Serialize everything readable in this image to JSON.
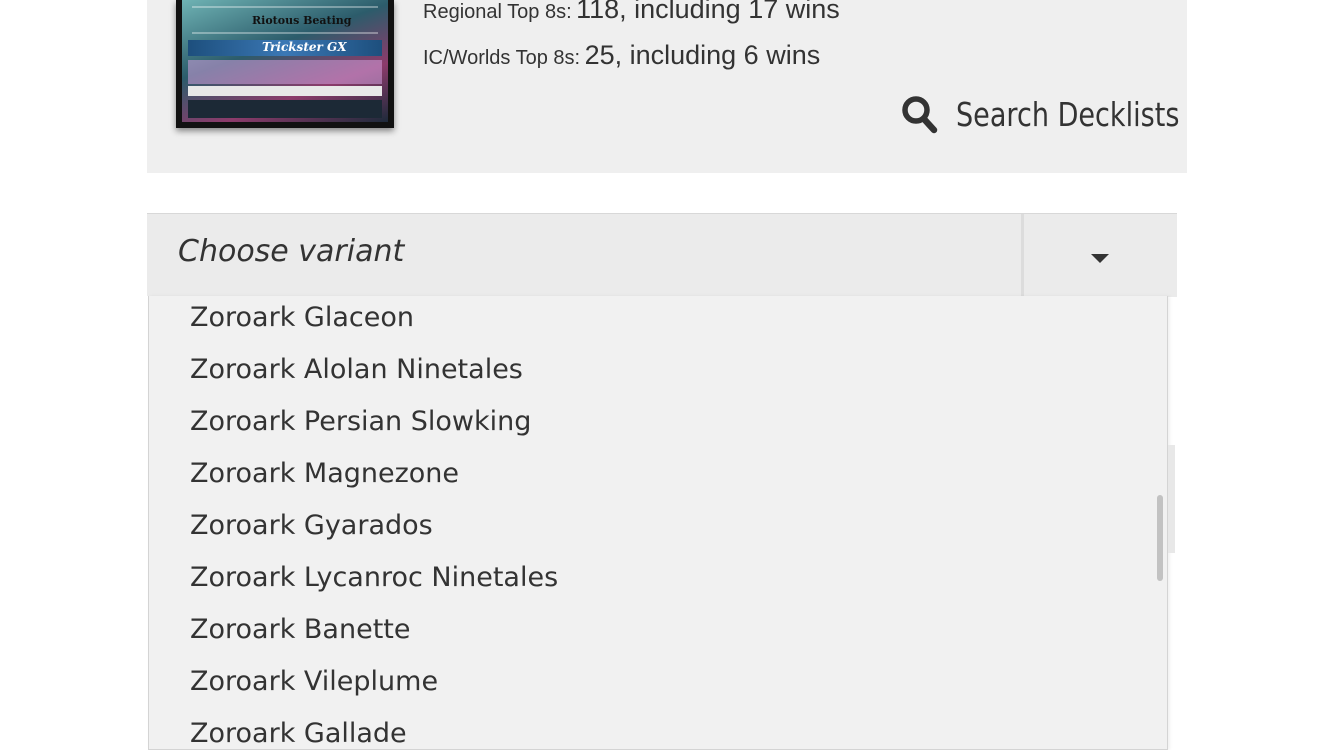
{
  "stats": {
    "regional_label": "Regional Top 8s:",
    "regional_value": "118, including 17 wins",
    "worlds_label": "IC/Worlds Top 8s:",
    "worlds_value": "25, including 6 wins"
  },
  "card": {
    "attack_name": "Riotous Beating",
    "gx_name": "Trickster GX"
  },
  "search": {
    "label": "Search Decklists",
    "icon": "search-icon"
  },
  "variant_select": {
    "placeholder": "Choose variant",
    "toggle_icon": "chevron-down-icon"
  },
  "options": [
    "Zoroark Glaceon",
    "Zoroark Alolan Ninetales",
    "Zoroark Persian Slowking",
    "Zoroark Magnezone",
    "Zoroark Gyarados",
    "Zoroark Lycanroc Ninetales",
    "Zoroark Banette",
    "Zoroark Vileplume",
    "Zoroark Gallade"
  ],
  "colors": {
    "panel_bg": "#efefef",
    "dropdown_bg": "#f1f1f1",
    "text": "#333333"
  }
}
